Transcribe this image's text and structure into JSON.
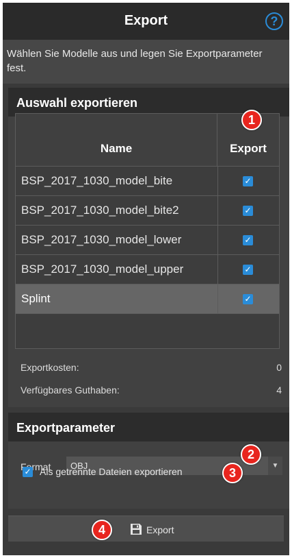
{
  "header": {
    "title": "Export",
    "help_icon": "question-circle-icon",
    "help_glyph": "?"
  },
  "description": "Wählen Sie Modelle aus und legen Sie Exportparameter fest.",
  "selection_section": {
    "title": "Auswahl exportieren",
    "columns": {
      "name": "Name",
      "export": "Export"
    },
    "rows": [
      {
        "name": "BSP_2017_1030_model_bite",
        "export": true,
        "selected": false
      },
      {
        "name": "BSP_2017_1030_model_bite2",
        "export": true,
        "selected": false
      },
      {
        "name": "BSP_2017_1030_model_lower",
        "export": true,
        "selected": false
      },
      {
        "name": "BSP_2017_1030_model_upper",
        "export": true,
        "selected": false
      },
      {
        "name": "Splint",
        "export": true,
        "selected": true
      }
    ],
    "export_costs_label": "Exportkosten:",
    "export_costs_value": "0",
    "available_credit_label": "Verfügbares Guthaben:",
    "available_credit_value": "4"
  },
  "parameters_section": {
    "title": "Exportparameter",
    "format_label": "Format",
    "format_value": "OBJ",
    "separate_files_label": "Als getrennte Dateien exportieren",
    "separate_files_checked": true
  },
  "export_button": {
    "label": "Export",
    "icon": "floppy-disk-icon"
  },
  "callouts": [
    "1",
    "2",
    "3",
    "4"
  ],
  "colors": {
    "accent": "#2a8cd8",
    "callout": "#e8251e"
  }
}
